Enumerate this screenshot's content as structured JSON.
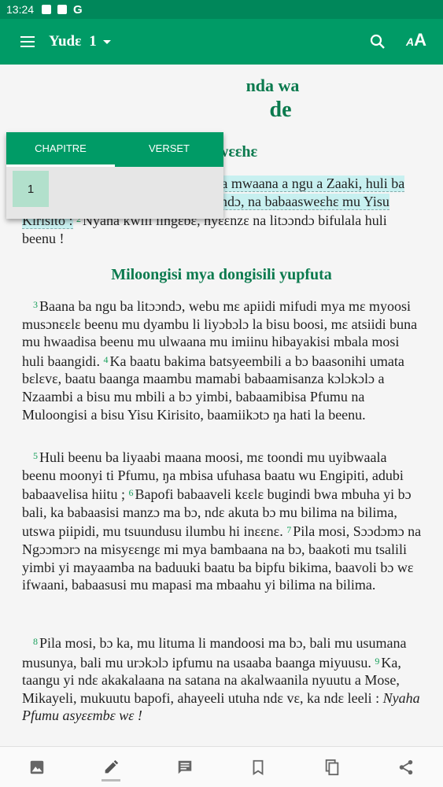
{
  "status_bar": {
    "time": "13:24",
    "icons": [
      "image-icon",
      "font-icon",
      "google-icon"
    ],
    "google_letter": "G"
  },
  "app_bar": {
    "book": "Yudɛ",
    "chapter": "1",
    "menu_icon": "menu-icon",
    "search_icon": "search-icon",
    "font_icon": "font-size-icon",
    "font_icon_small": "A",
    "font_icon_big": "A"
  },
  "picker": {
    "tabs": [
      "CHAPITRE",
      "VERSET"
    ],
    "active_tab": "CHAPITRE",
    "chapters": [
      "1"
    ]
  },
  "content": {
    "title_top": "nda wa",
    "title_big": "de",
    "heading_1": "Mabwɛɛhɛ",
    "chapter_number": "1",
    "v1": "Yude, musalili a Yisu Kirisito, na mwaana a ngu a Zaaki, huli ba baatɛɛlɛ, ba Nzaambi Taata atɔɔndɔ, na babaasweɛhɛ mu Yisu Kirisito :",
    "v2_num": "2",
    "v2": "Nyaha kwili lingɛbɛ, hyɛɛnzɛ na litɔɔndɔ bifulala huli beenu !",
    "heading_2": "Miloongisi mya dongisili yupfuta",
    "v3_num": "3",
    "v3": "Baana ba ngu ba litɔɔndɔ, webu mɛ apiidi mifudi mya mɛ myoosi musɔnɛɛlɛ beenu mu dyambu li liyɔbɔlɔ la bisu boosi, mɛ atsiidi buna mu hwaadisa beenu mu ulwaana mu imiinu hibayakisi mbala mosi huli baangidi.",
    "v4_num": "4",
    "v4": "Ka baatu bakima batsyeembili a bɔ baasonihi umata bɛlɛvɛ, baatu baanga maambu mamabi babaamisanza kɔlɔkɔlɔ a Nzaambi a bisu mu mbili a bɔ yimbi, babaamibisa Pfumu na Muloongisi a bisu Yisu Kirisito, baamiikɔtɔ ŋa hati la beenu.",
    "v5_num": "5",
    "v5": "Huli beenu ba liyaabi maana moosi, mɛ toondi mu uyibwaala beenu moonyi ti Pfumu, ŋa mbisa ufuhasa baatu wu Engipiti, adubi babaavelisa hiitu ;",
    "v6_num": "6",
    "v6": "Bapofi babaaveli kɛɛlɛ bugindi bwa mbuha yi bɔ bali, ka babaasisi manzɔ ma bɔ, ndɛ akuta bɔ mu bilima na bilima, utswa piipidi, mu tsuundusu ilumbu hi inɛɛnɛ.",
    "v7_num": "7",
    "v7": "Pila mosi, Sɔɔdɔmɔ na Ngɔɔmɔrɔ na misyɛɛngɛ mi mya bambaana na bɔ, baakoti mu tsalili yimbi yi mayaamba na baduuki baatu ba bipfu bikima, baavoli bɔ wɛ ifwaani, babaasusi mu mapasi ma mbaahu yi bilima na bilima.",
    "v8_num": "8",
    "v8": "Pila mosi, bɔ ka, mu lituma li mandoosi ma bɔ, bali mu usumana musunya, bali mu urɔkɔlɔ ipfumu na usaaba baanga miyuusu.",
    "v9_num": "9",
    "v9": "Ka, taangu yi ndɛ akakalaana na satana na akalwaanila nyuutu a Mose, Mikayeli, mukuutu bapofi, ahayeeli utuha ndɛ vɛ, ka ndɛ leeli :",
    "v9_quote": "Nyaha Pfumu asyɛɛmbɛ wɛ !"
  },
  "bottom_bar": {
    "buttons": [
      "image-icon",
      "edit-icon",
      "comment-icon",
      "bookmark-icon",
      "copy-icon",
      "share-icon"
    ],
    "active": "edit-icon"
  },
  "colors": {
    "primary": "#009b66",
    "status": "#00875a",
    "heading": "#0b7a4e",
    "highlight": "#c8f0f0",
    "verse_num": "#19a05c"
  }
}
